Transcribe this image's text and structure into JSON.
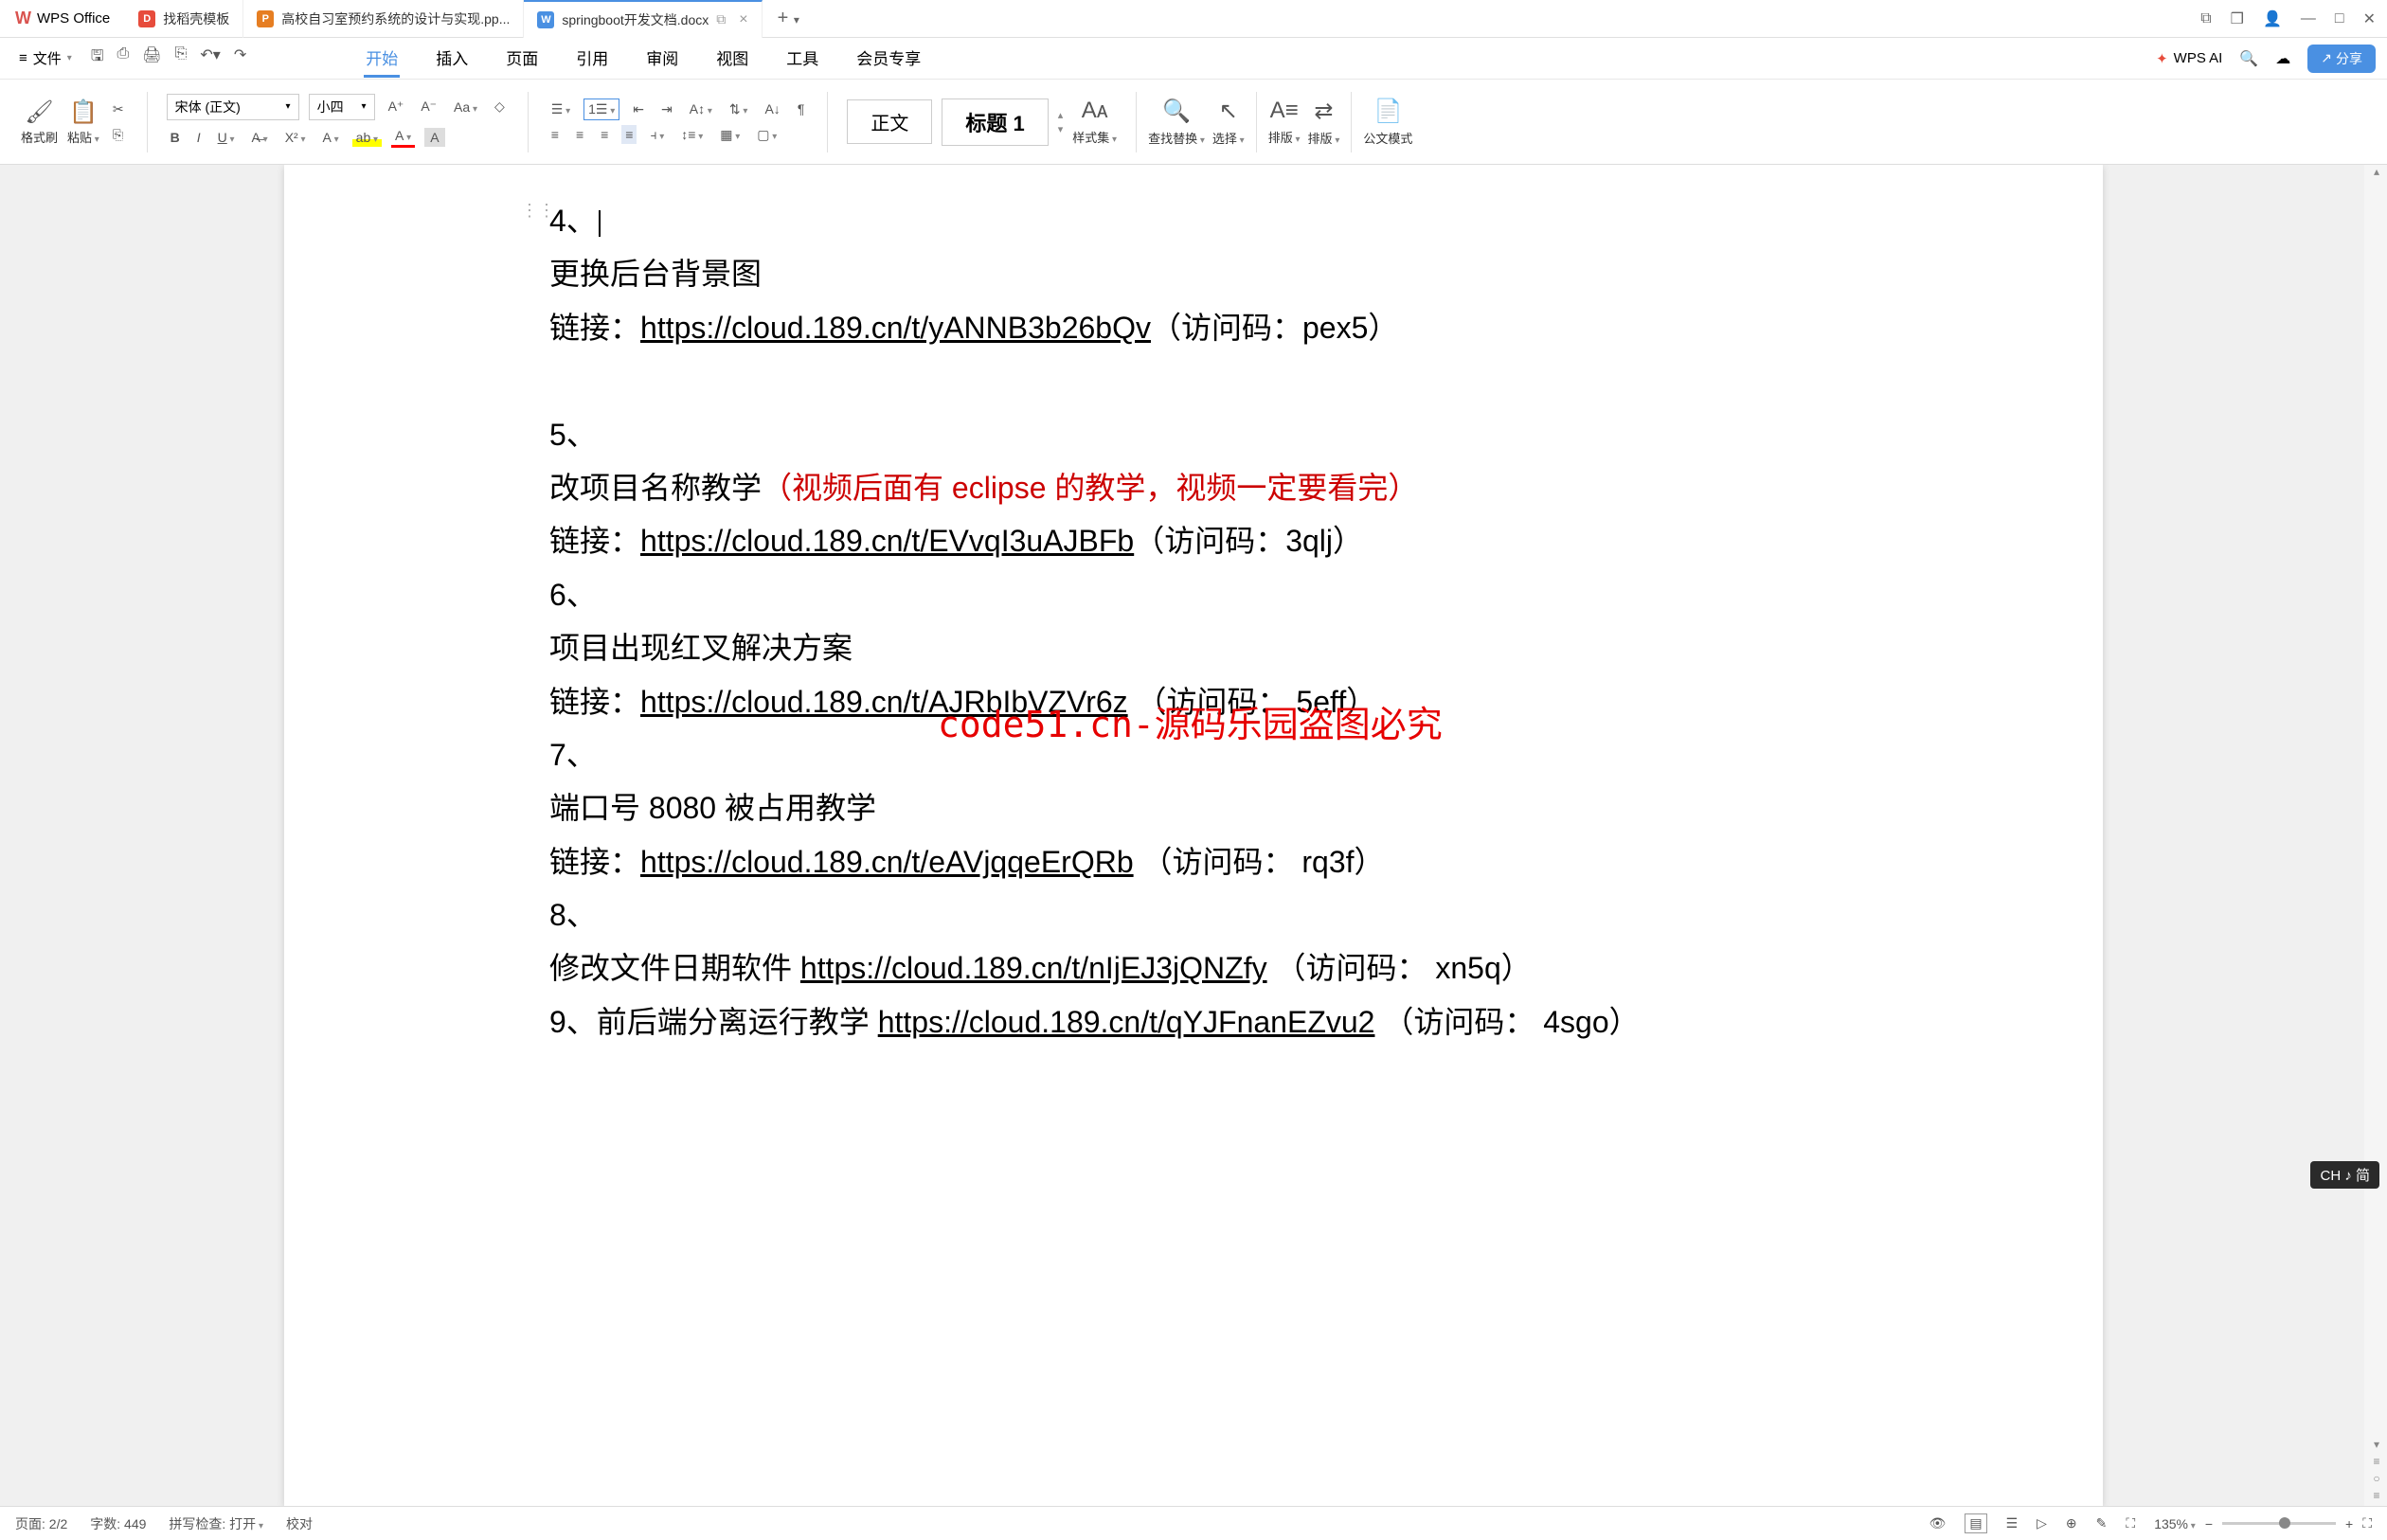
{
  "app": {
    "name": "WPS Office"
  },
  "tabs": [
    {
      "icon": "D",
      "label": "找稻壳模板"
    },
    {
      "icon": "P",
      "label": "高校自习室预约系统的设计与实现.pp..."
    },
    {
      "icon": "W",
      "label": "springboot开发文档.docx",
      "active": true
    }
  ],
  "fileMenu": "文件",
  "menuTabs": {
    "start": "开始",
    "insert": "插入",
    "page": "页面",
    "ref": "引用",
    "review": "审阅",
    "view": "视图",
    "tools": "工具",
    "vip": "会员专享"
  },
  "wpsAI": "WPS AI",
  "shareBtn": "分享",
  "ribbon": {
    "formatPainter": "格式刷",
    "paste": "粘贴",
    "fontName": "宋体 (正文)",
    "fontSize": "小四",
    "styleBody": "正文",
    "styleHeading": "标题 1",
    "styleSet": "样式集",
    "findReplace": "查找替换",
    "select": "选择",
    "layout": "排版",
    "layout2": "排版",
    "gongwen": "公文模式"
  },
  "document": {
    "item4_num": "4、",
    "item4_title": "更换后台背景图",
    "item4_link_label": "链接：",
    "item4_link": "https://cloud.189.cn/t/yANNB3b26bQv",
    "item4_code": "（访问码：pex5）",
    "item5_num": "5、",
    "item5_title": "改项目名称教学",
    "item5_note": "（视频后面有 eclipse 的教学，视频一定要看完）",
    "item5_link_label": "链接：",
    "item5_link": "https://cloud.189.cn/t/EVvqI3uAJBFb",
    "item5_code": "（访问码：3qlj）",
    "item6_num": "6、",
    "item6_title": "项目出现红叉解决方案",
    "item6_link_label": "链接：",
    "item6_link": "https://cloud.189.cn/t/AJRbIbVZVr6z",
    "item6_code": "  （访问码： 5eff）",
    "item7_num": "7、",
    "item7_title": "端口号 8080 被占用教学",
    "item7_link_label": "链接：",
    "item7_link": "https://cloud.189.cn/t/eAVjqqeErQRb",
    "item7_code": "  （访问码： rq3f）",
    "item8_num": "8、",
    "item8_title_pre": "修改文件日期软件 ",
    "item8_link": "https://cloud.189.cn/t/nIjEJ3jQNZfy",
    "item8_code": "  （访问码： xn5q）",
    "item9_pre": "9、前后端分离运行教学 ",
    "item9_link": "https://cloud.189.cn/t/qYJFnanEZvu2",
    "item9_code": "  （访问码： 4sgo）"
  },
  "watermark": "code51.cn-源码乐园盗图必究",
  "status": {
    "page": "页面: 2/2",
    "words": "字数: 449",
    "spell": "拼写检查: 打开",
    "proof": "校对",
    "zoom": "135%"
  },
  "ime": "CH ♪ 简"
}
